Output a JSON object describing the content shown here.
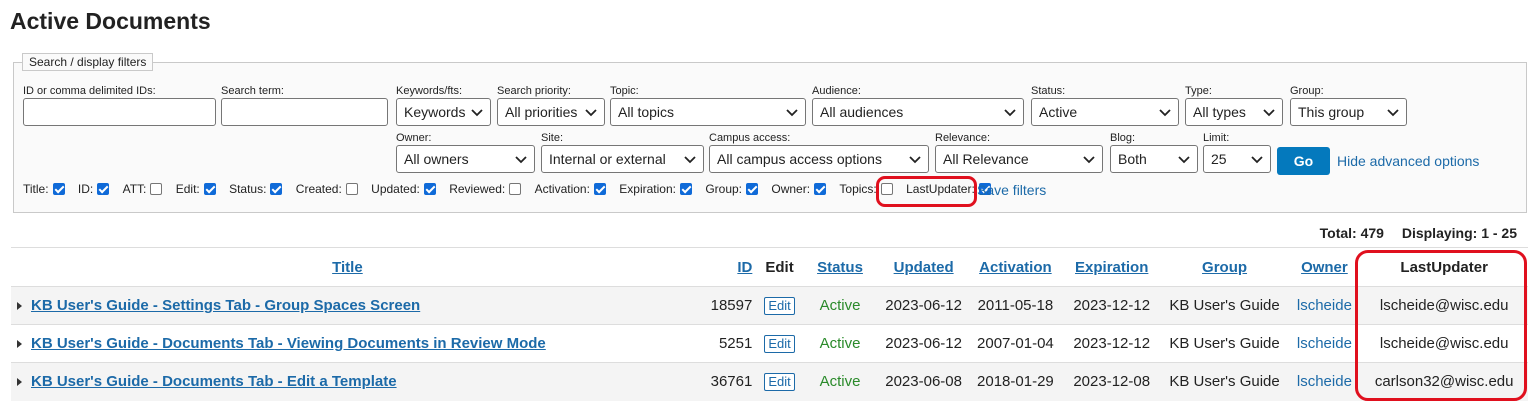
{
  "page": {
    "title": "Active Documents"
  },
  "filters": {
    "legend": "Search / display filters",
    "id_label": "ID or comma delimited IDs:",
    "id_value": "",
    "term_label": "Search term:",
    "term_value": "",
    "keywords": {
      "label": "Keywords/fts:",
      "value": "Keywords"
    },
    "priority": {
      "label": "Search priority:",
      "value": "All priorities"
    },
    "topic": {
      "label": "Topic:",
      "value": "All topics"
    },
    "audience": {
      "label": "Audience:",
      "value": "All audiences"
    },
    "status": {
      "label": "Status:",
      "value": "Active"
    },
    "type": {
      "label": "Type:",
      "value": "All types"
    },
    "group": {
      "label": "Group:",
      "value": "This group"
    },
    "owner": {
      "label": "Owner:",
      "value": "All owners"
    },
    "site": {
      "label": "Site:",
      "value": "Internal or external"
    },
    "campus": {
      "label": "Campus access:",
      "value": "All campus access options"
    },
    "relevance": {
      "label": "Relevance:",
      "value": "All Relevance"
    },
    "blog": {
      "label": "Blog:",
      "value": "Both"
    },
    "limit": {
      "label": "Limit:",
      "value": "25"
    },
    "go_label": "Go",
    "advanced_link": "Hide advanced options",
    "save_link": "Save filters",
    "columns": [
      {
        "label": "Title:",
        "checked": true
      },
      {
        "label": "ID:",
        "checked": true
      },
      {
        "label": "ATT:",
        "checked": false
      },
      {
        "label": "Edit:",
        "checked": true
      },
      {
        "label": "Status:",
        "checked": true
      },
      {
        "label": "Created:",
        "checked": false
      },
      {
        "label": "Updated:",
        "checked": true
      },
      {
        "label": "Reviewed:",
        "checked": false
      },
      {
        "label": "Activation:",
        "checked": true
      },
      {
        "label": "Expiration:",
        "checked": true
      },
      {
        "label": "Group:",
        "checked": true
      },
      {
        "label": "Owner:",
        "checked": true
      },
      {
        "label": "Topics:",
        "checked": false
      },
      {
        "label": "LastUpdater:",
        "checked": true
      }
    ]
  },
  "summary": {
    "total": "Total: 479",
    "displaying": "Displaying: 1 - 25"
  },
  "table": {
    "headers": {
      "title": "Title",
      "id": "ID",
      "edit": "Edit",
      "status": "Status",
      "updated": "Updated",
      "activation": "Activation",
      "expiration": "Expiration",
      "group": "Group",
      "owner": "Owner",
      "lastupdater": "LastUpdater"
    },
    "rows": [
      {
        "title": "KB User's Guide - Settings Tab - Group Spaces Screen",
        "id": "18597",
        "edit": "Edit",
        "status": "Active",
        "updated": "2023-06-12",
        "activation": "2011-05-18",
        "expiration": "2023-12-12",
        "group": "KB User's Guide",
        "owner": "lscheide",
        "lastupdater": "lscheide@wisc.edu"
      },
      {
        "title": "KB User's Guide - Documents Tab - Viewing Documents in Review Mode",
        "id": "5251",
        "edit": "Edit",
        "status": "Active",
        "updated": "2023-06-12",
        "activation": "2007-01-04",
        "expiration": "2023-12-12",
        "group": "KB User's Guide",
        "owner": "lscheide",
        "lastupdater": "lscheide@wisc.edu"
      },
      {
        "title": "KB User's Guide - Documents Tab - Edit a Template",
        "id": "36761",
        "edit": "Edit",
        "status": "Active",
        "updated": "2023-06-08",
        "activation": "2018-01-29",
        "expiration": "2023-12-08",
        "group": "KB User's Guide",
        "owner": "lscheide",
        "lastupdater": "carlson32@wisc.edu"
      }
    ]
  },
  "colors": {
    "accent": "#0479bd",
    "link": "#1c6aa8",
    "active": "#2a8a2a",
    "highlight": "#e0101e"
  }
}
